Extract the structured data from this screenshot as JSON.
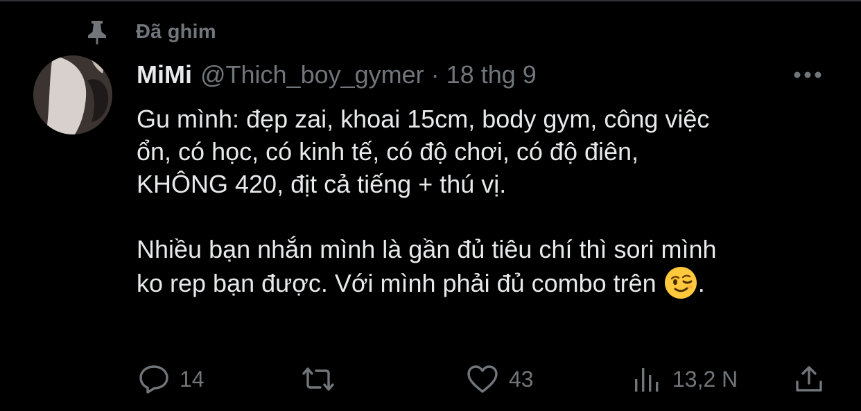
{
  "pinned": {
    "label": "Đã ghim",
    "icon": "pin-icon"
  },
  "tweet": {
    "author": {
      "display_name": "MiMi",
      "handle": "@Thich_boy_gymer"
    },
    "separator": "·",
    "timestamp": "18 thg 9",
    "more_icon": "more-dots-icon",
    "body": {
      "line1": "Gu mình: đẹp zai, khoai 15cm, body gym, công việc",
      "line2": "ổn, có học, có kinh tế, có độ chơi, có độ điên,",
      "line3": "KHÔNG 420, địt cả tiếng + thú vị.",
      "line4": "Nhiều bạn nhắn mình là gần đủ tiêu chí thì sori mình",
      "line5_before_emoji": "ko rep bạn được. Với mình phải đủ combo trên ",
      "emoji": "winking-face-emoji",
      "line5_after_emoji": "."
    },
    "actions": {
      "reply": {
        "count": "14",
        "icon": "reply-icon"
      },
      "retweet": {
        "count": "",
        "icon": "retweet-icon"
      },
      "like": {
        "count": "43",
        "icon": "heart-icon"
      },
      "views": {
        "count": "13,2 N",
        "icon": "views-bar-chart-icon"
      },
      "share": {
        "icon": "share-icon"
      }
    }
  },
  "colors": {
    "background": "#000000",
    "primary_text": "#e7e9ea",
    "secondary_text": "#71767b",
    "divider": "#2f3336",
    "emoji_face": "#ffc83d"
  }
}
